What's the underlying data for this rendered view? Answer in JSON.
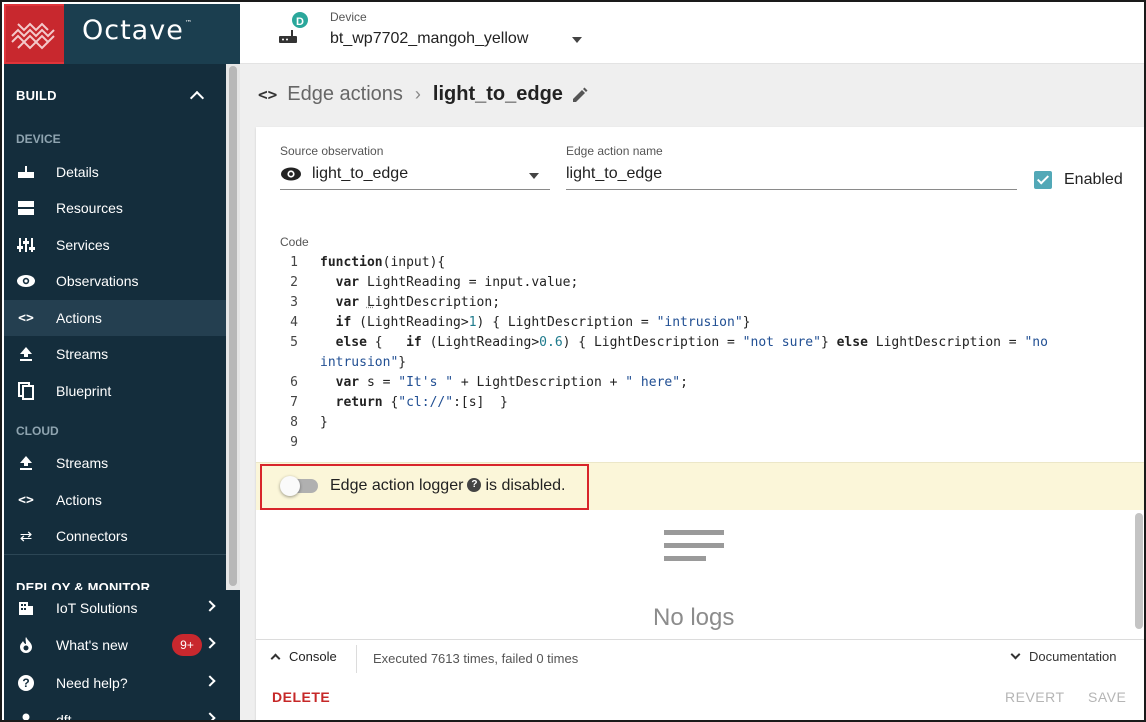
{
  "brand": {
    "name": "Octave",
    "tm": "™",
    "accent": "#c8282e",
    "header_bg": "#1b3e4f"
  },
  "device": {
    "label": "Device",
    "name": "bt_wp7702_mangoh_yellow",
    "badge": "D"
  },
  "sidebar": {
    "build_label": "BUILD",
    "device_group": "DEVICE",
    "device_items": [
      {
        "label": "Details",
        "icon": "router-icon"
      },
      {
        "label": "Resources",
        "icon": "storage-icon"
      },
      {
        "label": "Services",
        "icon": "sliders-icon"
      },
      {
        "label": "Observations",
        "icon": "eye-icon"
      },
      {
        "label": "Actions",
        "icon": "code-icon"
      },
      {
        "label": "Streams",
        "icon": "upload-icon"
      },
      {
        "label": "Blueprint",
        "icon": "copy-icon"
      }
    ],
    "cloud_group": "CLOUD",
    "cloud_items": [
      {
        "label": "Streams",
        "icon": "upload-icon"
      },
      {
        "label": "Actions",
        "icon": "code-icon"
      },
      {
        "label": "Connectors",
        "icon": "swap-icon"
      }
    ],
    "deploy_label": "DEPLOY & MONITOR",
    "bottom_items": [
      {
        "label": "IoT Solutions",
        "icon": "building-icon"
      },
      {
        "label": "What's new",
        "icon": "fire-icon",
        "badge": "9+"
      },
      {
        "label": "Need help?",
        "icon": "help-icon"
      },
      {
        "label": "dft",
        "icon": "person-icon"
      }
    ]
  },
  "breadcrumb": {
    "code_icon": "<>",
    "parent": "Edge actions",
    "current": "light_to_edge"
  },
  "form": {
    "source_label": "Source observation",
    "source_value": "light_to_edge",
    "name_label": "Edge action name",
    "name_value": "light_to_edge",
    "enabled_label": "Enabled",
    "enabled": true,
    "code_label": "Code"
  },
  "code_lines": [
    "1",
    "2",
    "3",
    "4",
    "5",
    "",
    "6",
    "7",
    "8",
    "9"
  ],
  "logger": {
    "prefix": "Edge action logger",
    "suffix": "is disabled.",
    "help": "?"
  },
  "logs": {
    "empty_text": "No logs"
  },
  "console": {
    "tab_label": "Console",
    "status": "Executed 7613 times, failed 0 times",
    "doc_label": "Documentation"
  },
  "actions": {
    "delete": "DELETE",
    "revert": "REVERT",
    "save": "SAVE"
  }
}
